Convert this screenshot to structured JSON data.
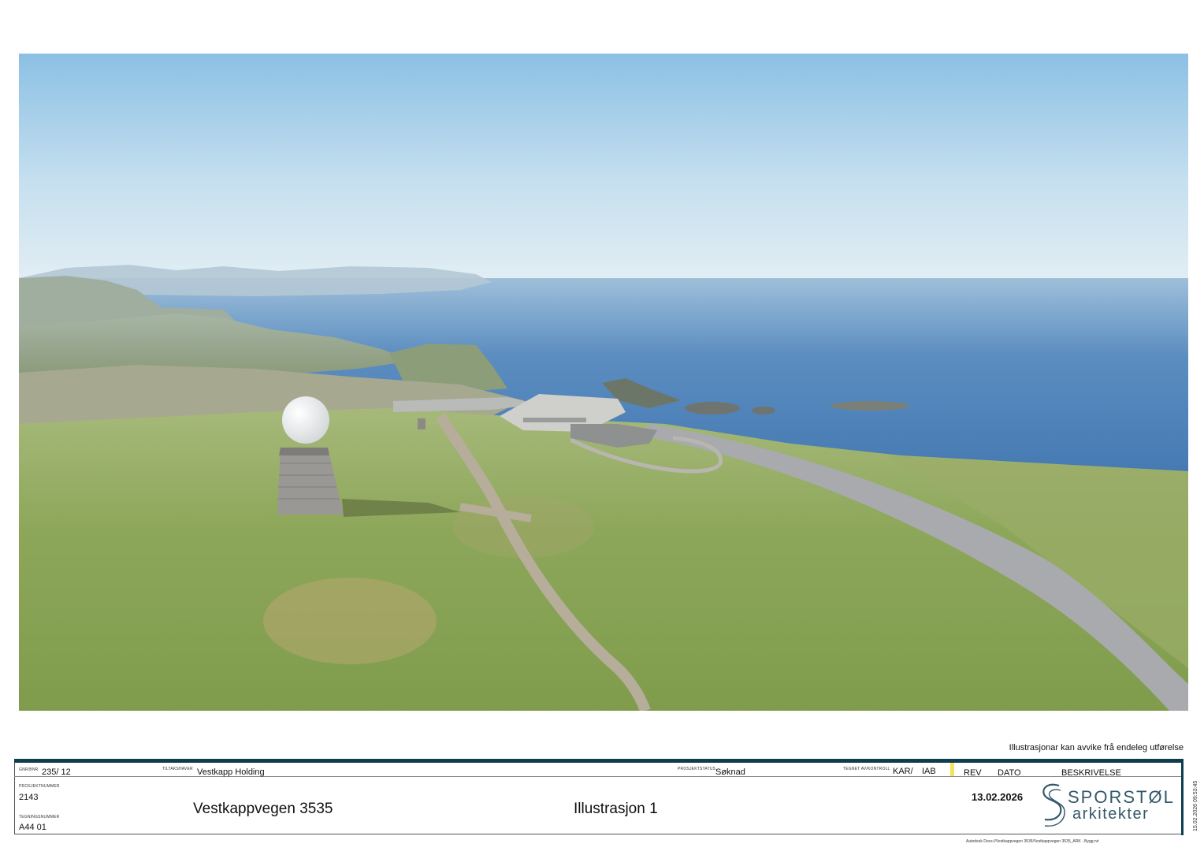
{
  "disclaimer": "Illustrasjonar kan avvike frå endeleg utførelse",
  "titleblock": {
    "gnr_bnr_label": "GNR/BNR",
    "gnr_bnr_value": "235/ 12",
    "tiltakshaver_label": "TILTAKSHAVER",
    "tiltakshaver_value": "Vestkapp Holding",
    "prosjektstatus_label": "PROSJEKTSTATUS",
    "prosjektstatus_value": "Søknad",
    "tegnet_label": "TEGNET AV/KONTROLL",
    "tegnet_value_1": "KAR/",
    "tegnet_value_2": "IAB",
    "rev_label": "REV",
    "dato_label": "DATO",
    "beskrivelse_label": "BESKRIVELSE",
    "prosjektnummer_label": "PROSJEKTNUMMER",
    "prosjektnummer_value": "2143",
    "tegningsnummer_label": "TEGNINGSNUMMER",
    "tegningsnummer_value": "A44 01",
    "project_name": "Vestkappvegen 3535",
    "drawing_title": "Illustrasjon 1",
    "date": "13.02.2026",
    "logo_line1": "SPORSTØL",
    "logo_line2": "arkitekter",
    "file_path": "Autodesk Docs://Vestkappvegen 3535/Vestkappvegen 3535_ARK - Bygg.rvt",
    "timestamp": "15.02.2026 09:53:45"
  },
  "colors": {
    "brand": "#0f3d4e",
    "logo": "#34586a",
    "rev_marker": "#f5e15a",
    "sky_top": "#8fc3e6",
    "sea": "#3f79b3",
    "grass": "#8ea95a"
  }
}
